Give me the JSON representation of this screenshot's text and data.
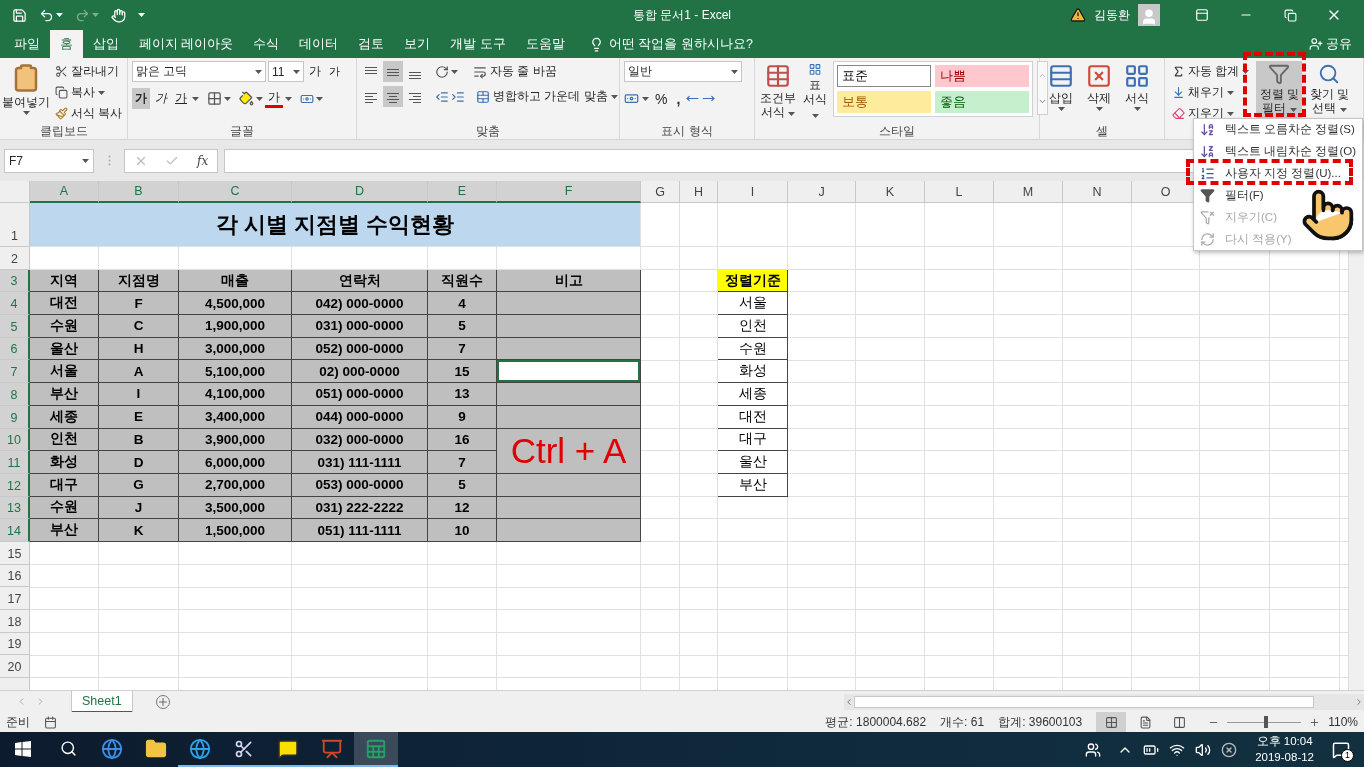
{
  "title_bar": {
    "document_title": "통합 문서1  -  Excel",
    "user_name": "김동환"
  },
  "ribbon_tabs": [
    {
      "label": "파일",
      "selected": false
    },
    {
      "label": "홈",
      "selected": true
    },
    {
      "label": "삽입",
      "selected": false
    },
    {
      "label": "페이지 레이아웃",
      "selected": false
    },
    {
      "label": "수식",
      "selected": false
    },
    {
      "label": "데이터",
      "selected": false
    },
    {
      "label": "검토",
      "selected": false
    },
    {
      "label": "보기",
      "selected": false
    },
    {
      "label": "개발 도구",
      "selected": false
    },
    {
      "label": "도움말",
      "selected": false
    }
  ],
  "tell_me": "어떤 작업을 원하시나요?",
  "share": "공유",
  "ribbon": {
    "clipboard": {
      "label": "클립보드",
      "paste": "붙여넣기",
      "cut": "잘라내기",
      "copy": "복사",
      "format_painter": "서식 복사"
    },
    "font": {
      "label": "글꼴",
      "font_name": "맑은 고딕",
      "font_size": "11",
      "grow": "가",
      "shrink": "가",
      "bold": {
        "text": "가",
        "on": true
      },
      "italic": {
        "text": "가",
        "on": false
      },
      "underline": {
        "text": "가",
        "on": false
      },
      "font_color": "가"
    },
    "alignment": {
      "label": "맞춤",
      "wrap_text": "자동 줄 바꿈",
      "merge_center": "병합하고 가운데 맞춤",
      "vertical": [
        {
          "kind": "top",
          "selected": false
        },
        {
          "kind": "middle",
          "selected": true
        },
        {
          "kind": "bottom",
          "selected": false
        }
      ],
      "horizontal": [
        {
          "kind": "left",
          "selected": false
        },
        {
          "kind": "center",
          "selected": true
        },
        {
          "kind": "right",
          "selected": false
        }
      ]
    },
    "number": {
      "label": "표시 형식",
      "format": "일반",
      "percent": "%",
      "comma": ","
    },
    "styles": {
      "label": "스타일",
      "conditional": "조건부 서식",
      "format_table": "표 서식",
      "cells": [
        {
          "label": "표준",
          "color": "#ffffff"
        },
        {
          "label": "나쁨",
          "color": "#ffc7ce"
        },
        {
          "label": "보통",
          "color": "#ffeb9c"
        },
        {
          "label": "좋음",
          "color": "#c6efce"
        }
      ]
    },
    "cells": {
      "label": "셀",
      "buttons": [
        {
          "label": "삽입",
          "kind": "insert"
        },
        {
          "label": "삭제",
          "kind": "delete"
        },
        {
          "label": "서식",
          "kind": "format"
        }
      ]
    },
    "editing": {
      "autosum": "자동 합계",
      "fill": "채우기",
      "clear": "지우기",
      "sort_filter": {
        "label": "정렬 및 필터",
        "pressed": true
      },
      "find_select": "찾기 및 선택"
    }
  },
  "formula_bar": {
    "name_box": "F7",
    "fx": "fx"
  },
  "sort_menu": [
    {
      "label": "텍스트 오름차순 정렬(S)",
      "kind": "sort-asc",
      "disabled": false
    },
    {
      "label": "텍스트 내림차순 정렬(O)",
      "kind": "sort-desc",
      "disabled": false
    },
    {
      "label": "사용자 지정 정렬(U)...",
      "kind": "custom",
      "disabled": false
    },
    {
      "label": "필터(F)",
      "kind": "filter",
      "disabled": false
    },
    {
      "label": "지우기(C)",
      "kind": "clear",
      "disabled": true
    },
    {
      "label": "다시 적용(Y)",
      "kind": "reapply",
      "disabled": true
    }
  ],
  "sheet": {
    "columns": [
      {
        "letter": "A",
        "selected": true
      },
      {
        "letter": "B",
        "selected": true
      },
      {
        "letter": "C",
        "selected": true
      },
      {
        "letter": "D",
        "selected": true
      },
      {
        "letter": "E",
        "selected": true
      },
      {
        "letter": "F",
        "selected": true
      },
      {
        "letter": "G",
        "selected": false
      },
      {
        "letter": "H",
        "selected": false
      },
      {
        "letter": "I",
        "selected": false
      },
      {
        "letter": "J",
        "selected": false
      },
      {
        "letter": "K",
        "selected": false
      },
      {
        "letter": "L",
        "selected": false
      },
      {
        "letter": "M",
        "selected": false
      },
      {
        "letter": "N",
        "selected": false
      },
      {
        "letter": "O",
        "selected": false
      }
    ],
    "rows": [
      {
        "number": "1",
        "selected": false
      },
      {
        "number": "2",
        "selected": false
      },
      {
        "number": "3",
        "selected": true
      },
      {
        "number": "4",
        "selected": true
      },
      {
        "number": "5",
        "selected": true
      },
      {
        "number": "6",
        "selected": true
      },
      {
        "number": "7",
        "selected": true
      },
      {
        "number": "8",
        "selected": true
      },
      {
        "number": "9",
        "selected": true
      },
      {
        "number": "10",
        "selected": true
      },
      {
        "number": "11",
        "selected": true
      },
      {
        "number": "12",
        "selected": true
      },
      {
        "number": "13",
        "selected": true
      },
      {
        "number": "14",
        "selected": true
      },
      {
        "number": "15",
        "selected": false
      },
      {
        "number": "16",
        "selected": false
      },
      {
        "number": "17",
        "selected": false
      },
      {
        "number": "18",
        "selected": false
      },
      {
        "number": "19",
        "selected": false
      },
      {
        "number": "20",
        "selected": false
      }
    ],
    "title": "각 시별 지점별 수익현황",
    "table": {
      "selected": true,
      "headers": [
        "지역",
        "지점명",
        "매출",
        "연락처",
        "직원수",
        "비고"
      ],
      "rows": [
        {
          "values": [
            "대전",
            "F",
            "4,500,000",
            "042) 000-0000",
            "4"
          ]
        },
        {
          "values": [
            "수원",
            "C",
            "1,900,000",
            "031) 000-0000",
            "5"
          ]
        },
        {
          "values": [
            "울산",
            "H",
            "3,000,000",
            "052) 000-0000",
            "7"
          ]
        },
        {
          "values": [
            "서울",
            "A",
            "5,100,000",
            "02) 000-0000",
            "15"
          ]
        },
        {
          "values": [
            "부산",
            "I",
            "4,100,000",
            "051) 000-0000",
            "13"
          ]
        },
        {
          "values": [
            "세종",
            "E",
            "3,400,000",
            "044) 000-0000",
            "9"
          ]
        },
        {
          "values": [
            "인천",
            "B",
            "3,900,000",
            "032) 000-0000",
            "16"
          ],
          "annotation": "Ctrl + A"
        },
        {
          "values": [
            "화성",
            "D",
            "6,000,000",
            "031) 111-1111",
            "7"
          ]
        },
        {
          "values": [
            "대구",
            "G",
            "2,700,000",
            "053) 000-0000",
            "5"
          ]
        },
        {
          "values": [
            "수원",
            "J",
            "3,500,000",
            "031) 222-2222",
            "12"
          ]
        },
        {
          "values": [
            "부산",
            "K",
            "1,500,000",
            "051) 111-1111",
            "10"
          ]
        }
      ]
    },
    "criteria": {
      "header": "정렬기준",
      "items": [
        "서울",
        "인천",
        "수원",
        "화성",
        "세종",
        "대전",
        "대구",
        "울산",
        "부산"
      ]
    }
  },
  "sheet_tabs": [
    {
      "label": "Sheet1",
      "selected": true
    }
  ],
  "status_bar": {
    "mode": "준비",
    "average": "평균: 1800004.682",
    "count": "개수: 61",
    "sum": "합계: 39600103",
    "views": [
      {
        "kind": "normal",
        "selected": true
      },
      {
        "kind": "page-layout",
        "selected": false
      },
      {
        "kind": "page-break",
        "selected": false
      }
    ],
    "zoom": {
      "level": 0.52,
      "reading": "110%"
    }
  },
  "taskbar": {
    "apps": [
      {
        "kind": "edge",
        "running": false,
        "selected": false
      },
      {
        "kind": "explorer",
        "running": false,
        "selected": false
      },
      {
        "kind": "ie",
        "running": true,
        "selected": false
      },
      {
        "kind": "snip",
        "running": true,
        "selected": false
      },
      {
        "kind": "chat",
        "running": true,
        "selected": false
      },
      {
        "kind": "slides",
        "running": true,
        "selected": false
      },
      {
        "kind": "sheets",
        "running": true,
        "selected": true
      }
    ],
    "time": "오후 10:04",
    "date": "2019-08-12",
    "notifications": "1"
  }
}
